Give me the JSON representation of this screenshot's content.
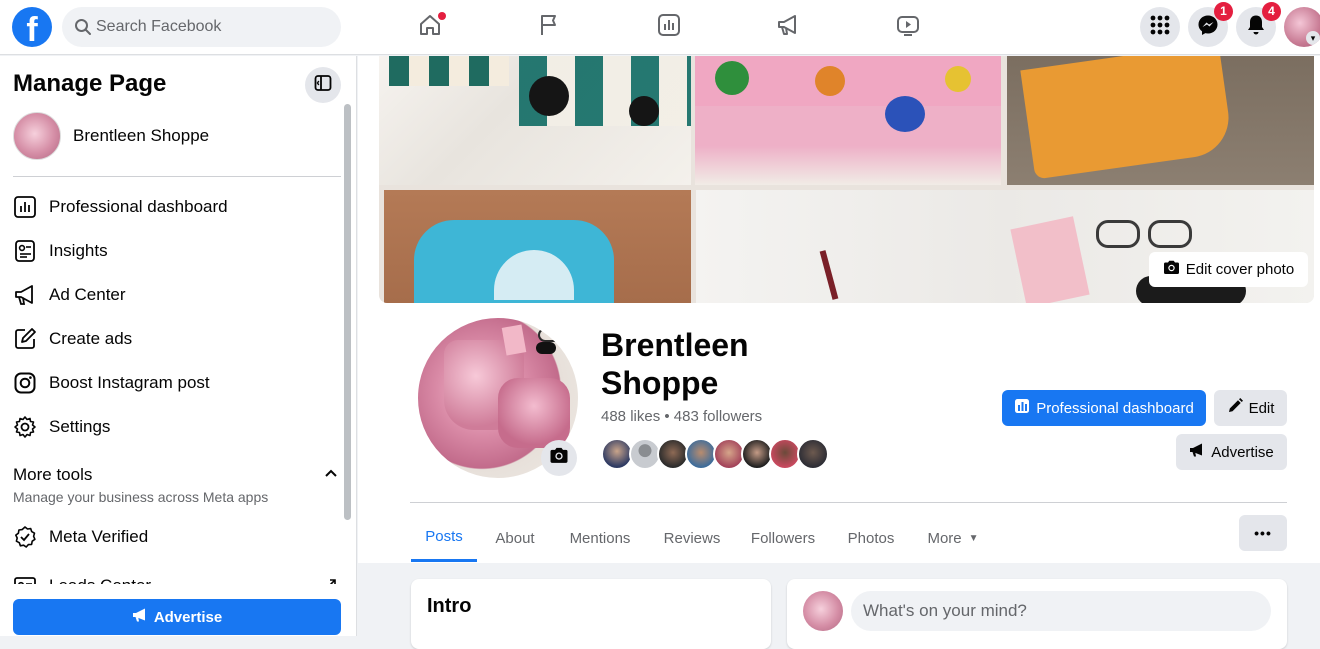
{
  "topbar": {
    "logo_letter": "f",
    "search_placeholder": "Search Facebook",
    "nav_icons": [
      "home-icon",
      "flag-icon",
      "dashboard-icon",
      "megaphone-icon",
      "video-icon"
    ],
    "messenger_badge": "1",
    "notifications_badge": "4"
  },
  "sidebar": {
    "title": "Manage Page",
    "page_name": "Brentleen Shoppe",
    "items": [
      {
        "label": "Professional dashboard",
        "icon": "dashboard-icon"
      },
      {
        "label": "Insights",
        "icon": "insights-icon"
      },
      {
        "label": "Ad Center",
        "icon": "megaphone-icon"
      },
      {
        "label": "Create ads",
        "icon": "pencil-icon"
      },
      {
        "label": "Boost Instagram post",
        "icon": "instagram-icon"
      },
      {
        "label": "Settings",
        "icon": "gear-icon"
      }
    ],
    "more_tools": {
      "title": "More tools",
      "subtitle": "Manage your business across Meta apps",
      "items": [
        {
          "label": "Meta Verified",
          "icon": "verified-badge-icon"
        },
        {
          "label": "Leads Center",
          "icon": "leads-icon"
        }
      ]
    },
    "advertise_label": "Advertise"
  },
  "profile": {
    "edit_cover_label": "Edit cover photo",
    "name": "Brentleen Shoppe",
    "stats": "488 likes • 483 followers",
    "professional_dashboard_label": "Professional dashboard",
    "edit_label": "Edit",
    "advertise_label": "Advertise"
  },
  "tabs": [
    {
      "label": "Posts",
      "active": true
    },
    {
      "label": "About",
      "active": false
    },
    {
      "label": "Mentions",
      "active": false
    },
    {
      "label": "Reviews",
      "active": false
    },
    {
      "label": "Followers",
      "active": false
    },
    {
      "label": "Photos",
      "active": false
    },
    {
      "label": "More",
      "active": false
    }
  ],
  "more_options_label": "•••",
  "intro": {
    "title": "Intro"
  },
  "composer": {
    "placeholder": "What's on your mind?"
  },
  "colors": {
    "brand": "#1877f2",
    "badge": "#e41e3f",
    "bg": "#f0f2f5"
  }
}
